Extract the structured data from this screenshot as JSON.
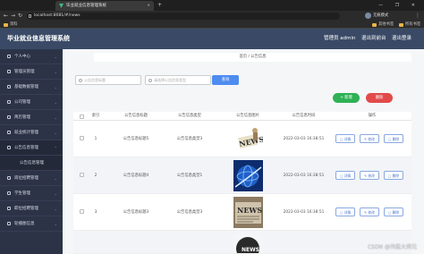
{
  "browser": {
    "tab_title": "毕业就业信息管理系统",
    "tab_close": "×",
    "new_tab": "+",
    "window_controls": "— ❐ ✕",
    "url": "localhost:8081/#/news",
    "profile": "无痕模式",
    "bookmarks": [
      "资料",
      "其他书签",
      "所有书签"
    ]
  },
  "header": {
    "title": "毕业就业信息管理系统",
    "user": "管理员 admin",
    "logout": "退出到前台",
    "login_out": "退出登录"
  },
  "sidebar": {
    "items": [
      {
        "label": "个人中心",
        "icon": "user-icon"
      },
      {
        "label": "管理员管理",
        "icon": "admin-icon"
      },
      {
        "label": "基础数据管理",
        "icon": "data-icon"
      },
      {
        "label": "公司管理",
        "icon": "company-icon"
      },
      {
        "label": "简历管理",
        "icon": "resume-icon"
      },
      {
        "label": "就业统计管理",
        "icon": "stats-icon"
      },
      {
        "label": "公告信息管理",
        "icon": "notice-icon"
      },
      {
        "label": "公告信息管理",
        "icon": "notice-icon"
      },
      {
        "label": "岗位招聘管理",
        "icon": "job-icon"
      },
      {
        "label": "学生管理",
        "icon": "student-icon"
      },
      {
        "label": "职位招聘管理",
        "icon": "position-icon"
      },
      {
        "label": "轮播图信息",
        "icon": "carousel-icon"
      }
    ]
  },
  "breadcrumb": "首页 / 公告信息",
  "search": {
    "title_placeholder": "公告信息标题",
    "type_placeholder": "请选择公告信息类型",
    "query_label": "查询"
  },
  "actions": {
    "add": "+ 新增",
    "delete": "删除"
  },
  "table": {
    "headers": [
      "索引",
      "公告信息标题",
      "公告信息类型",
      "公告信息图片",
      "公告信息时间",
      "操作"
    ],
    "rows": [
      {
        "index": "1",
        "title": "公告信息标题5",
        "type": "公告信息类型3",
        "time": "2022-03-03 16:38:51",
        "image": "news-paper"
      },
      {
        "index": "2",
        "title": "公告信息标题4",
        "type": "公告信息类型1",
        "time": "2022-03-03 16:38:51",
        "image": "news-globe"
      },
      {
        "index": "3",
        "title": "公告信息标题3",
        "type": "公告信息类型3",
        "time": "2022-03-03 16:38:51",
        "image": "news-newspaper"
      }
    ],
    "op_labels": {
      "detail": "详情",
      "edit": "修改",
      "delete": "删除"
    }
  },
  "watermark": "CSDN @伟庭大师兄"
}
